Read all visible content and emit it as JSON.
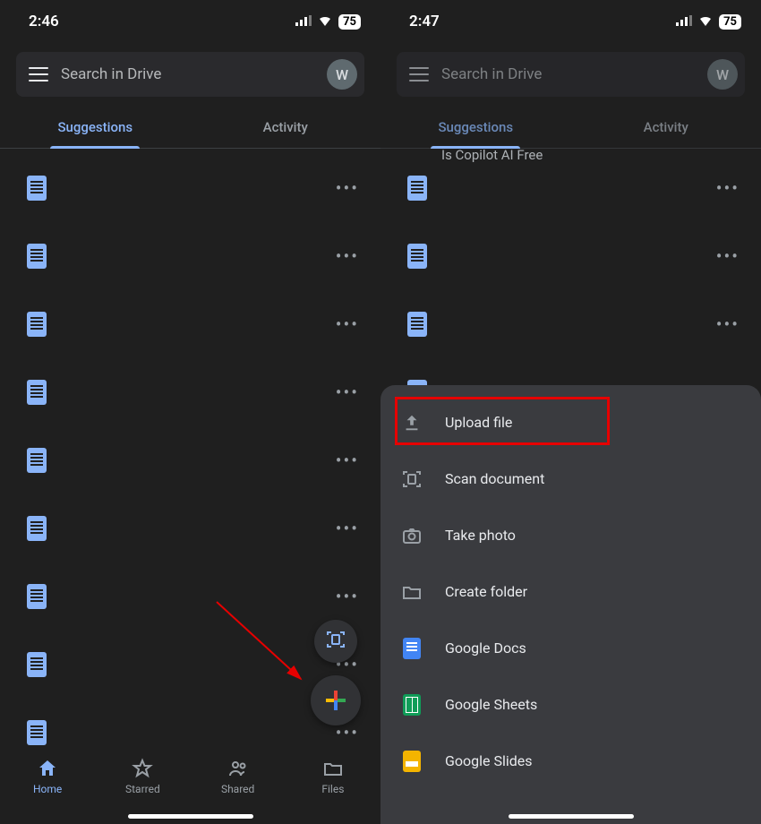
{
  "left": {
    "status": {
      "time": "2:46",
      "battery": "75"
    },
    "search": {
      "placeholder": "Search in Drive",
      "avatar_initial": "W"
    },
    "tabs": {
      "suggestions": "Suggestions",
      "activity": "Activity"
    },
    "nav": {
      "home": "Home",
      "starred": "Starred",
      "shared": "Shared",
      "files": "Files"
    }
  },
  "right": {
    "status": {
      "time": "2:47",
      "battery": "75"
    },
    "search": {
      "placeholder": "Search in Drive",
      "avatar_initial": "W"
    },
    "tabs": {
      "suggestions": "Suggestions",
      "activity": "Activity"
    },
    "partial_file_title": "Is Copilot AI Free",
    "sheet": {
      "upload_file": "Upload file",
      "scan_document": "Scan document",
      "take_photo": "Take photo",
      "create_folder": "Create folder",
      "google_docs": "Google Docs",
      "google_sheets": "Google Sheets",
      "google_slides": "Google Slides"
    }
  }
}
